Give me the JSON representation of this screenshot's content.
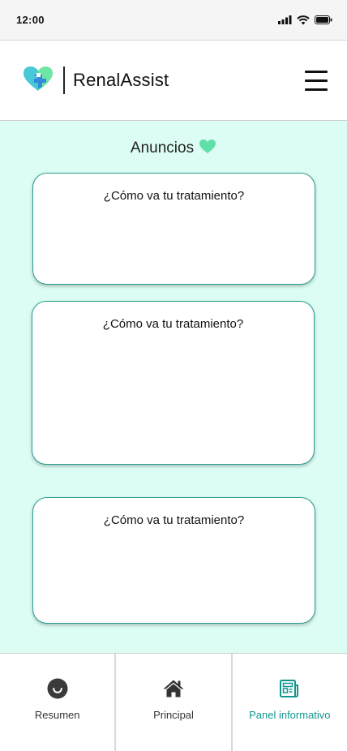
{
  "status_bar": {
    "time": "12:00",
    "icons": [
      "signal-icon",
      "wifi-icon",
      "battery-icon"
    ]
  },
  "header": {
    "app_name": "RenalAssist",
    "logo_icon": "heart-cross-logo",
    "menu_icon": "hamburger-menu-icon"
  },
  "announcements": {
    "title": "Anuncios",
    "title_icon": "heart-icon",
    "cards": [
      {
        "text": "¿Cómo va tu tratamiento?"
      },
      {
        "text": "¿Cómo va tu tratamiento?"
      },
      {
        "text": "¿Cómo va tu tratamiento?"
      }
    ]
  },
  "bottom_nav": {
    "items": [
      {
        "label": "Resumen",
        "icon": "smiley-icon",
        "active": false
      },
      {
        "label": "Principal",
        "icon": "home-icon",
        "active": false
      },
      {
        "label": "Panel informativo",
        "icon": "newspaper-icon",
        "active": true
      }
    ]
  },
  "colors": {
    "background": "#dcfdf4",
    "accent": "#11968f",
    "card_border": "#2a9d95",
    "heart": "#5ee0a8",
    "logo_teal": "#48c9d8",
    "logo_blue": "#2f7fe0",
    "logo_green": "#6ee6a5"
  }
}
